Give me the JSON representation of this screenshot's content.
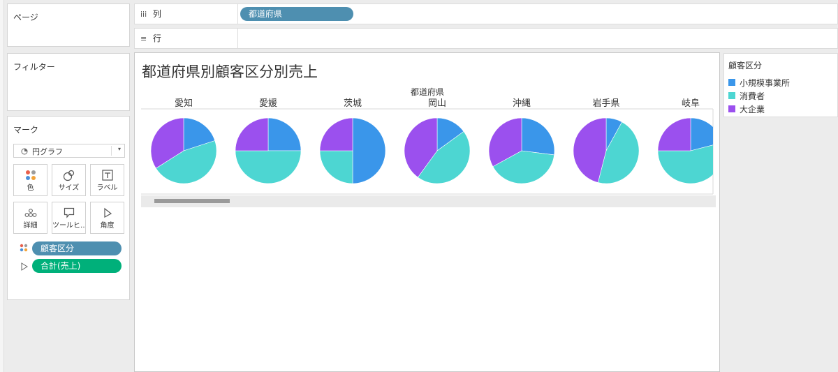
{
  "left_panels": {
    "pages_title": "ページ",
    "filters_title": "フィルター",
    "marks_title": "マーク",
    "mark_type": "円グラフ",
    "mark_buttons": [
      {
        "label": "色",
        "icon": "color-dots-icon"
      },
      {
        "label": "サイズ",
        "icon": "size-icon"
      },
      {
        "label": "ラベル",
        "icon": "label-icon"
      },
      {
        "label": "詳細",
        "icon": "detail-icon"
      },
      {
        "label": "ツールヒ…",
        "icon": "tooltip-icon"
      },
      {
        "label": "角度",
        "icon": "angle-icon"
      }
    ],
    "mark_pills": [
      {
        "label": "顧客区分",
        "color": "#4e8fb0"
      },
      {
        "label": "合計(売上)",
        "color": "#00b07a"
      }
    ]
  },
  "shelves": {
    "columns_label": "列",
    "rows_label": "行",
    "columns_pill": "都道府県"
  },
  "legend": {
    "title": "顧客区分",
    "items": [
      {
        "label": "小規模事業所",
        "color": "#3a96ea"
      },
      {
        "label": "消費者",
        "color": "#4dd6d2"
      },
      {
        "label": "大企業",
        "color": "#9b50ee"
      }
    ]
  },
  "chart_data": {
    "type": "pie",
    "title": "都道府県別顧客区分別売上",
    "column_header": "都道府県",
    "series_names": [
      "小規模事業所",
      "消費者",
      "大企業"
    ],
    "colors": [
      "#3a96ea",
      "#4dd6d2",
      "#9b50ee"
    ],
    "categories": [
      "愛知",
      "愛媛",
      "茨城",
      "岡山",
      "沖縄",
      "岩手県",
      "岐阜"
    ],
    "values": [
      [
        0.2,
        0.46,
        0.34
      ],
      [
        0.25,
        0.5,
        0.25
      ],
      [
        0.5,
        0.25,
        0.25
      ],
      [
        0.15,
        0.45,
        0.4
      ],
      [
        0.27,
        0.4,
        0.33
      ],
      [
        0.08,
        0.46,
        0.46
      ],
      [
        0.21,
        0.54,
        0.25
      ]
    ]
  }
}
